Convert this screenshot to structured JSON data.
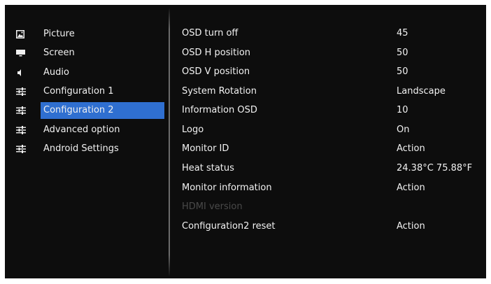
{
  "sidebar": {
    "items": [
      {
        "label": "Picture",
        "icon": "picture-icon",
        "selected": false
      },
      {
        "label": "Screen",
        "icon": "screen-icon",
        "selected": false
      },
      {
        "label": "Audio",
        "icon": "speaker-icon",
        "selected": false
      },
      {
        "label": "Configuration 1",
        "icon": "sliders-icon",
        "selected": false
      },
      {
        "label": "Configuration 2",
        "icon": "sliders-icon",
        "selected": true
      },
      {
        "label": "Advanced option",
        "icon": "sliders-icon",
        "selected": false
      },
      {
        "label": "Android Settings",
        "icon": "sliders-icon",
        "selected": false
      }
    ]
  },
  "settings": {
    "rows": [
      {
        "name": "OSD turn off",
        "value": "45",
        "enabled": true
      },
      {
        "name": "OSD H position",
        "value": "50",
        "enabled": true
      },
      {
        "name": "OSD V position",
        "value": "50",
        "enabled": true
      },
      {
        "name": "System Rotation",
        "value": "Landscape",
        "enabled": true
      },
      {
        "name": "Information OSD",
        "value": "10",
        "enabled": true
      },
      {
        "name": "Logo",
        "value": "On",
        "enabled": true
      },
      {
        "name": "Monitor ID",
        "value": "Action",
        "enabled": true
      },
      {
        "name": "Heat status",
        "value": "24.38°C 75.88°F",
        "enabled": true
      },
      {
        "name": "Monitor information",
        "value": "Action",
        "enabled": true
      },
      {
        "name": "HDMI version",
        "value": "",
        "enabled": false
      },
      {
        "name": "Configuration2 reset",
        "value": "Action",
        "enabled": true
      }
    ]
  },
  "colors": {
    "background": "#0d0d0d",
    "selection": "#2f6fd0",
    "text": "#f2f2f2",
    "disabled_text": "#4a4a4a"
  }
}
